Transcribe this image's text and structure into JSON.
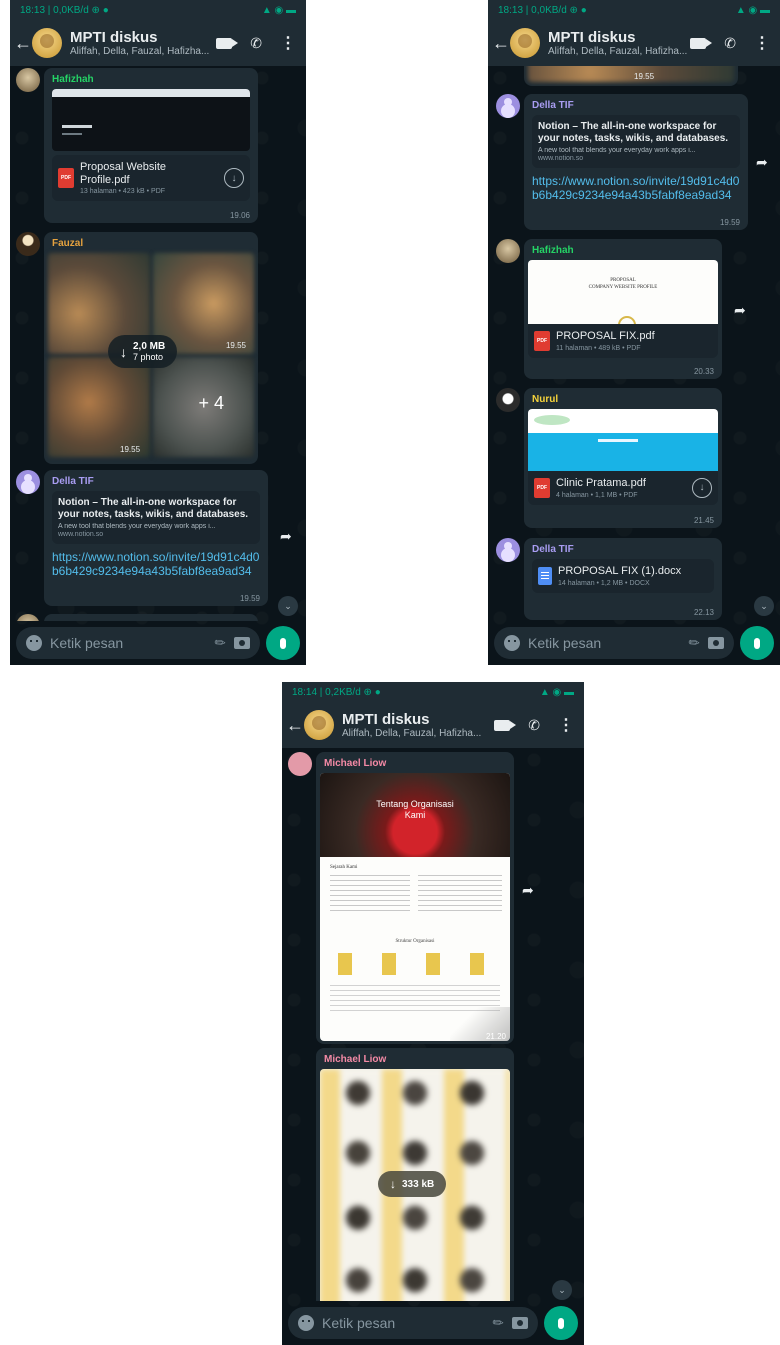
{
  "header": {
    "title": "MPTI diskus",
    "subtitle": "Aliffah, Della, Fauzal, Hafizha..."
  },
  "screens": [
    {
      "status_left": "18:13 | 0,0KB/d ⊕ ●",
      "messages": {
        "hafizhah": {
          "sender": "Hafizhah",
          "doc_name": "Proposal Website Profile.pdf",
          "doc_meta": "13 halaman • 423 kB • PDF",
          "time": "19.06"
        },
        "fauzal": {
          "sender": "Fauzal",
          "download_size": "2,0 MB",
          "photo_count": "7 photo",
          "more_count": "+ 4",
          "time_a": "19.55",
          "time_b": "19.55"
        },
        "della": {
          "sender": "Della TIF",
          "link_title": "Notion – The all-in-one workspace for your notes, tasks, wikis, and databases.",
          "link_desc": "A new tool that blends your everyday work apps i...",
          "link_domain": "www.notion.so",
          "url": "https://www.notion.so/invite/19d91c4d0b6b429c9234e94a43b5fabf8ea9ad34",
          "time": "19.59"
        }
      }
    },
    {
      "status_left": "18:13 | 0,0KB/d ⊕ ●",
      "messages": {
        "top_time": "19.55",
        "della": {
          "sender": "Della TIF",
          "link_title": "Notion – The all-in-one workspace for your notes, tasks, wikis, and databases.",
          "link_desc": "A new tool that blends your everyday work apps i...",
          "link_domain": "www.notion.so",
          "url": "https://www.notion.so/invite/19d91c4d0b6b429c9234e94a43b5fabf8ea9ad34",
          "time": "19.59"
        },
        "hafizhah": {
          "sender": "Hafizhah",
          "preview_line1": "PROPOSAL",
          "preview_line2": "COMPANY WEBSITE PROFILE",
          "doc_name": "PROPOSAL FIX.pdf",
          "doc_meta": "11 halaman • 489 kB • PDF",
          "time": "20.33"
        },
        "nurul": {
          "sender": "Nurul",
          "doc_name": "Clinic Pratama.pdf",
          "doc_meta": "4 halaman • 1,1 MB • PDF",
          "time": "21.45"
        },
        "della2": {
          "sender": "Della TIF",
          "doc_name": "PROPOSAL FIX (1).docx",
          "doc_meta": "14 halaman • 1,2 MB • DOCX",
          "time": "22.13"
        }
      }
    },
    {
      "status_left": "18:14 | 0,2KB/d ⊕ ●",
      "messages": {
        "michael1": {
          "sender": "Michael Liow",
          "hero_text": "Tentang Organisasi Kami",
          "section_title": "Sejarah Kami",
          "team_title": "Struktur Organisasi",
          "time": "21.20"
        },
        "michael2": {
          "sender": "Michael Liow",
          "download_size": "333 kB"
        }
      }
    }
  ],
  "input": {
    "placeholder": "Ketik pesan"
  },
  "colors": {
    "accent": "#00a884",
    "bubble": "#1f2c34",
    "link": "#53bdeb",
    "name_hafizhah": "#25d366",
    "name_fauzal": "#e5a23f",
    "name_della": "#a99df2",
    "name_nurul": "#f5d33b",
    "name_michael": "#f48aa6"
  }
}
